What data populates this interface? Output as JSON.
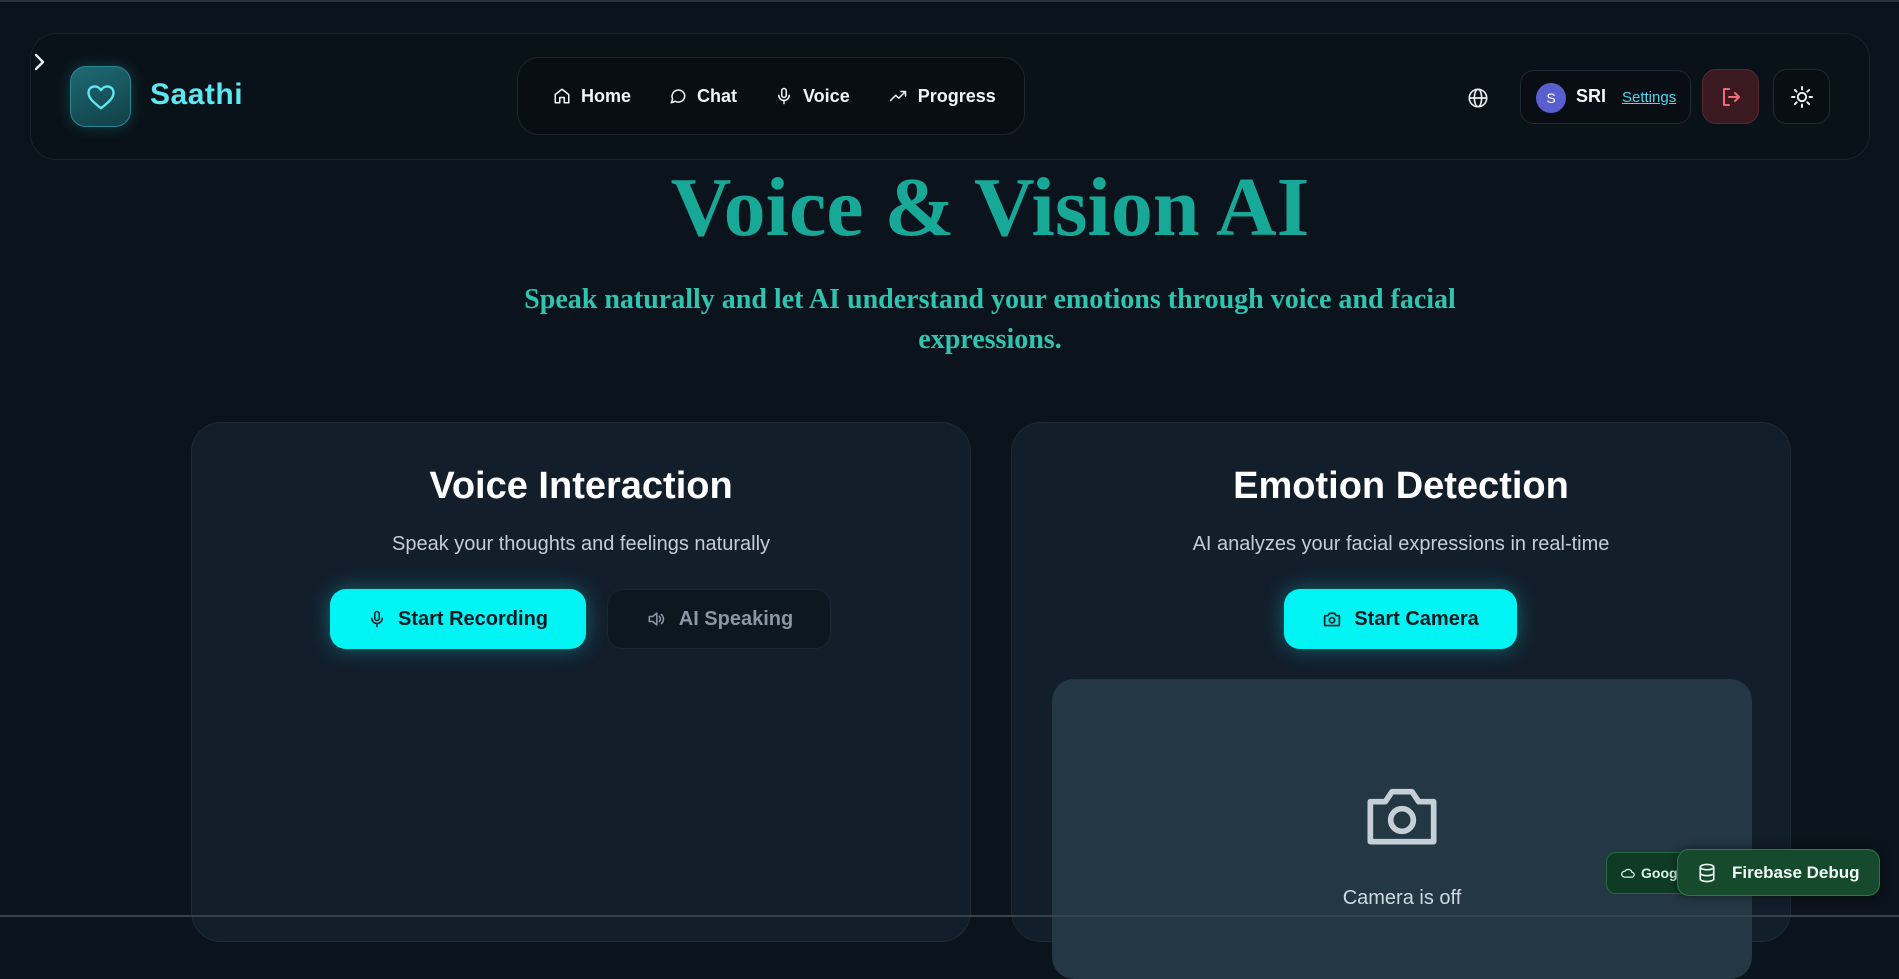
{
  "app": {
    "name": "Saathi"
  },
  "nav": {
    "items": [
      {
        "label": "Home",
        "icon": "home-icon"
      },
      {
        "label": "Chat",
        "icon": "chat-icon"
      },
      {
        "label": "Voice",
        "icon": "mic-icon"
      },
      {
        "label": "Progress",
        "icon": "trending-up-icon"
      }
    ]
  },
  "user": {
    "avatar_initial": "S",
    "name": "SRI",
    "settings_label": "Settings"
  },
  "hero": {
    "title": "Voice & Vision AI",
    "subtitle": "Speak naturally and let AI understand your emotions through voice and facial expressions."
  },
  "voice_card": {
    "title": "Voice Interaction",
    "description": "Speak your thoughts and feelings naturally",
    "record_label": "Start Recording",
    "speaking_label": "AI Speaking"
  },
  "emotion_card": {
    "title": "Emotion Detection",
    "description": "AI analyzes your facial expressions in real-time",
    "camera_button_label": "Start Camera",
    "camera_status": "Camera is off"
  },
  "badges": {
    "google_label": "Goog",
    "firebase_label": "Firebase Debug"
  },
  "colors": {
    "accent": "#00f4f4",
    "brand": "#5ee7f0",
    "hero_title": "#17a898",
    "background": "#0b141c"
  }
}
